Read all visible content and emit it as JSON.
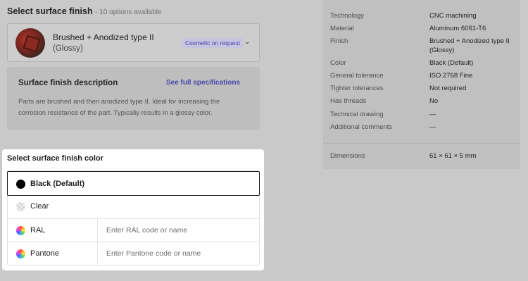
{
  "surface_finish": {
    "title": "Select surface finish",
    "options_count": "- 10 options available",
    "selected": {
      "name": "Brushed + Anodized type II",
      "variant": "(Glossy)",
      "badge": "Cosmetic on request"
    },
    "description": {
      "title": "Surface finish description",
      "link": "See full specifications",
      "body": "Parts are brushed and then anodized type II. Ideal for increasing the corrosion resistance of the part. Typically results in a glossy color."
    }
  },
  "specs": {
    "rows": [
      {
        "label": "Technology",
        "value": "CNC machining"
      },
      {
        "label": "Material",
        "value": "Aluminum 6061-T6"
      },
      {
        "label": "Finish",
        "value": "Brushed + Anodized type II (Glossy)"
      },
      {
        "label": "Color",
        "value": "Black (Default)"
      },
      {
        "label": "General tolerance",
        "value": "ISO 2768 Fine"
      },
      {
        "label": "Tighter tolerances",
        "value": "Not required"
      },
      {
        "label": "Has threads",
        "value": "No"
      },
      {
        "label": "Technical drawing",
        "value": "—"
      },
      {
        "label": "Additional comments",
        "value": "—"
      }
    ],
    "dimensions": {
      "label": "Dimensions",
      "value": "61 × 61 × 5 mm"
    }
  },
  "color_select": {
    "title": "Select surface finish color",
    "options": [
      {
        "label": "Black (Default)",
        "icon": "black-swatch-icon",
        "selected": true
      },
      {
        "label": "Clear",
        "icon": "clear-swatch-icon"
      },
      {
        "label": "RAL",
        "icon": "color-wheel-icon",
        "placeholder": "Enter RAL code or name",
        "value": ""
      },
      {
        "label": "Pantone",
        "icon": "color-wheel-icon",
        "placeholder": "Enter Pantone code or name",
        "value": ""
      }
    ]
  },
  "colors": {
    "accent": "#4a45ad",
    "overlay": "#c9c9c9",
    "panel": "#ffffff"
  }
}
